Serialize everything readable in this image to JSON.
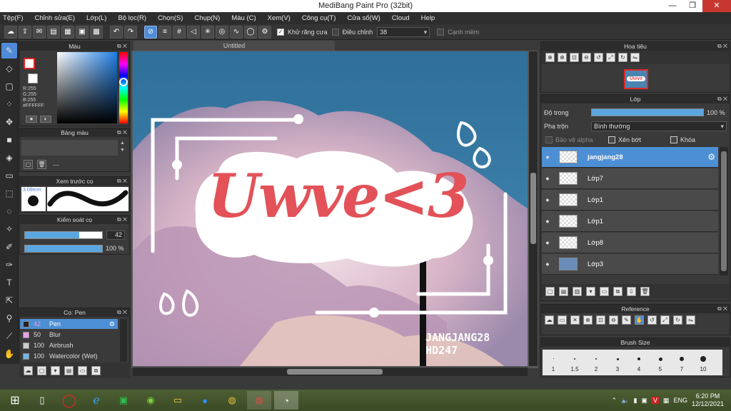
{
  "window": {
    "title": "MediBang Paint Pro (32bit)",
    "min": "—",
    "max": "❐",
    "close": "✕"
  },
  "menu": [
    "Tệp(F)",
    "Chỉnh sửa(E)",
    "Lớp(L)",
    "Bộ lọc(R)",
    "Chọn(S)",
    "Chụp(N)",
    "Màu (C)",
    "Xem(V)",
    "Công cụ(T)",
    "Cửa sổ(W)",
    "Cloud",
    "Help"
  ],
  "toolbar": {
    "antialias_label": "Khử răng cưa",
    "antialias_checked": "✓",
    "correction_label": "Điều chỉnh",
    "correction_value": "38",
    "edge_label": "Cạnh mềm"
  },
  "color_panel": {
    "title": "Màu",
    "r": "R:255",
    "g": "G:255",
    "b": "B:255",
    "hex": "#FFFFFF"
  },
  "palette_panel": {
    "title": "Bảng màu",
    "footer": "---"
  },
  "preview_panel": {
    "title": "Xem trước cọ",
    "size": "3.09mm"
  },
  "brush_control": {
    "title": "Kiểm soát cọ",
    "size_value": "42",
    "size_fraction": 0.7,
    "opacity_value": "100 %",
    "opacity_fraction": 1.0
  },
  "brush_panel": {
    "title": "Cọ: Pen",
    "items": [
      {
        "size": "42",
        "name": "Pen",
        "color": "#222222"
      },
      {
        "size": "50",
        "name": "Blur",
        "color": "#e8a0e8"
      },
      {
        "size": "100",
        "name": "Airbrush",
        "color": "#cccccc"
      },
      {
        "size": "100",
        "name": "Watercolor (Wet)",
        "color": "#6fb7e8"
      }
    ]
  },
  "canvas": {
    "tab": "Untitled",
    "art_title": "Uwve<3",
    "signature_1": "JANGJANG28",
    "signature_2": "HD247"
  },
  "navigator": {
    "title": "Hoa tiêu",
    "thumb_text": "Uwve"
  },
  "layers": {
    "title": "Lớp",
    "opacity_label": "Độ trong",
    "opacity_value": "100 %",
    "opacity_fraction": 1.0,
    "blend_label": "Pha trộn",
    "blend_value": "Bình thường",
    "protect_alpha": "Bảo vệ alpha",
    "clipping": "Xén bớt",
    "lock": "Khóa",
    "items": [
      {
        "name": "jangjang28"
      },
      {
        "name": "Lớp7"
      },
      {
        "name": "Lớp1"
      },
      {
        "name": "Lớp1"
      },
      {
        "name": "Lớp8"
      },
      {
        "name": "Lớp3"
      }
    ]
  },
  "reference": {
    "title": "Reference"
  },
  "brush_size": {
    "title": "Brush Size",
    "sizes": [
      "1",
      "1.5",
      "2",
      "3",
      "4",
      "5",
      "7",
      "10"
    ]
  },
  "taskbar": {
    "lang": "ENG",
    "time": "6:20 PM",
    "date": "12/12/2021"
  }
}
